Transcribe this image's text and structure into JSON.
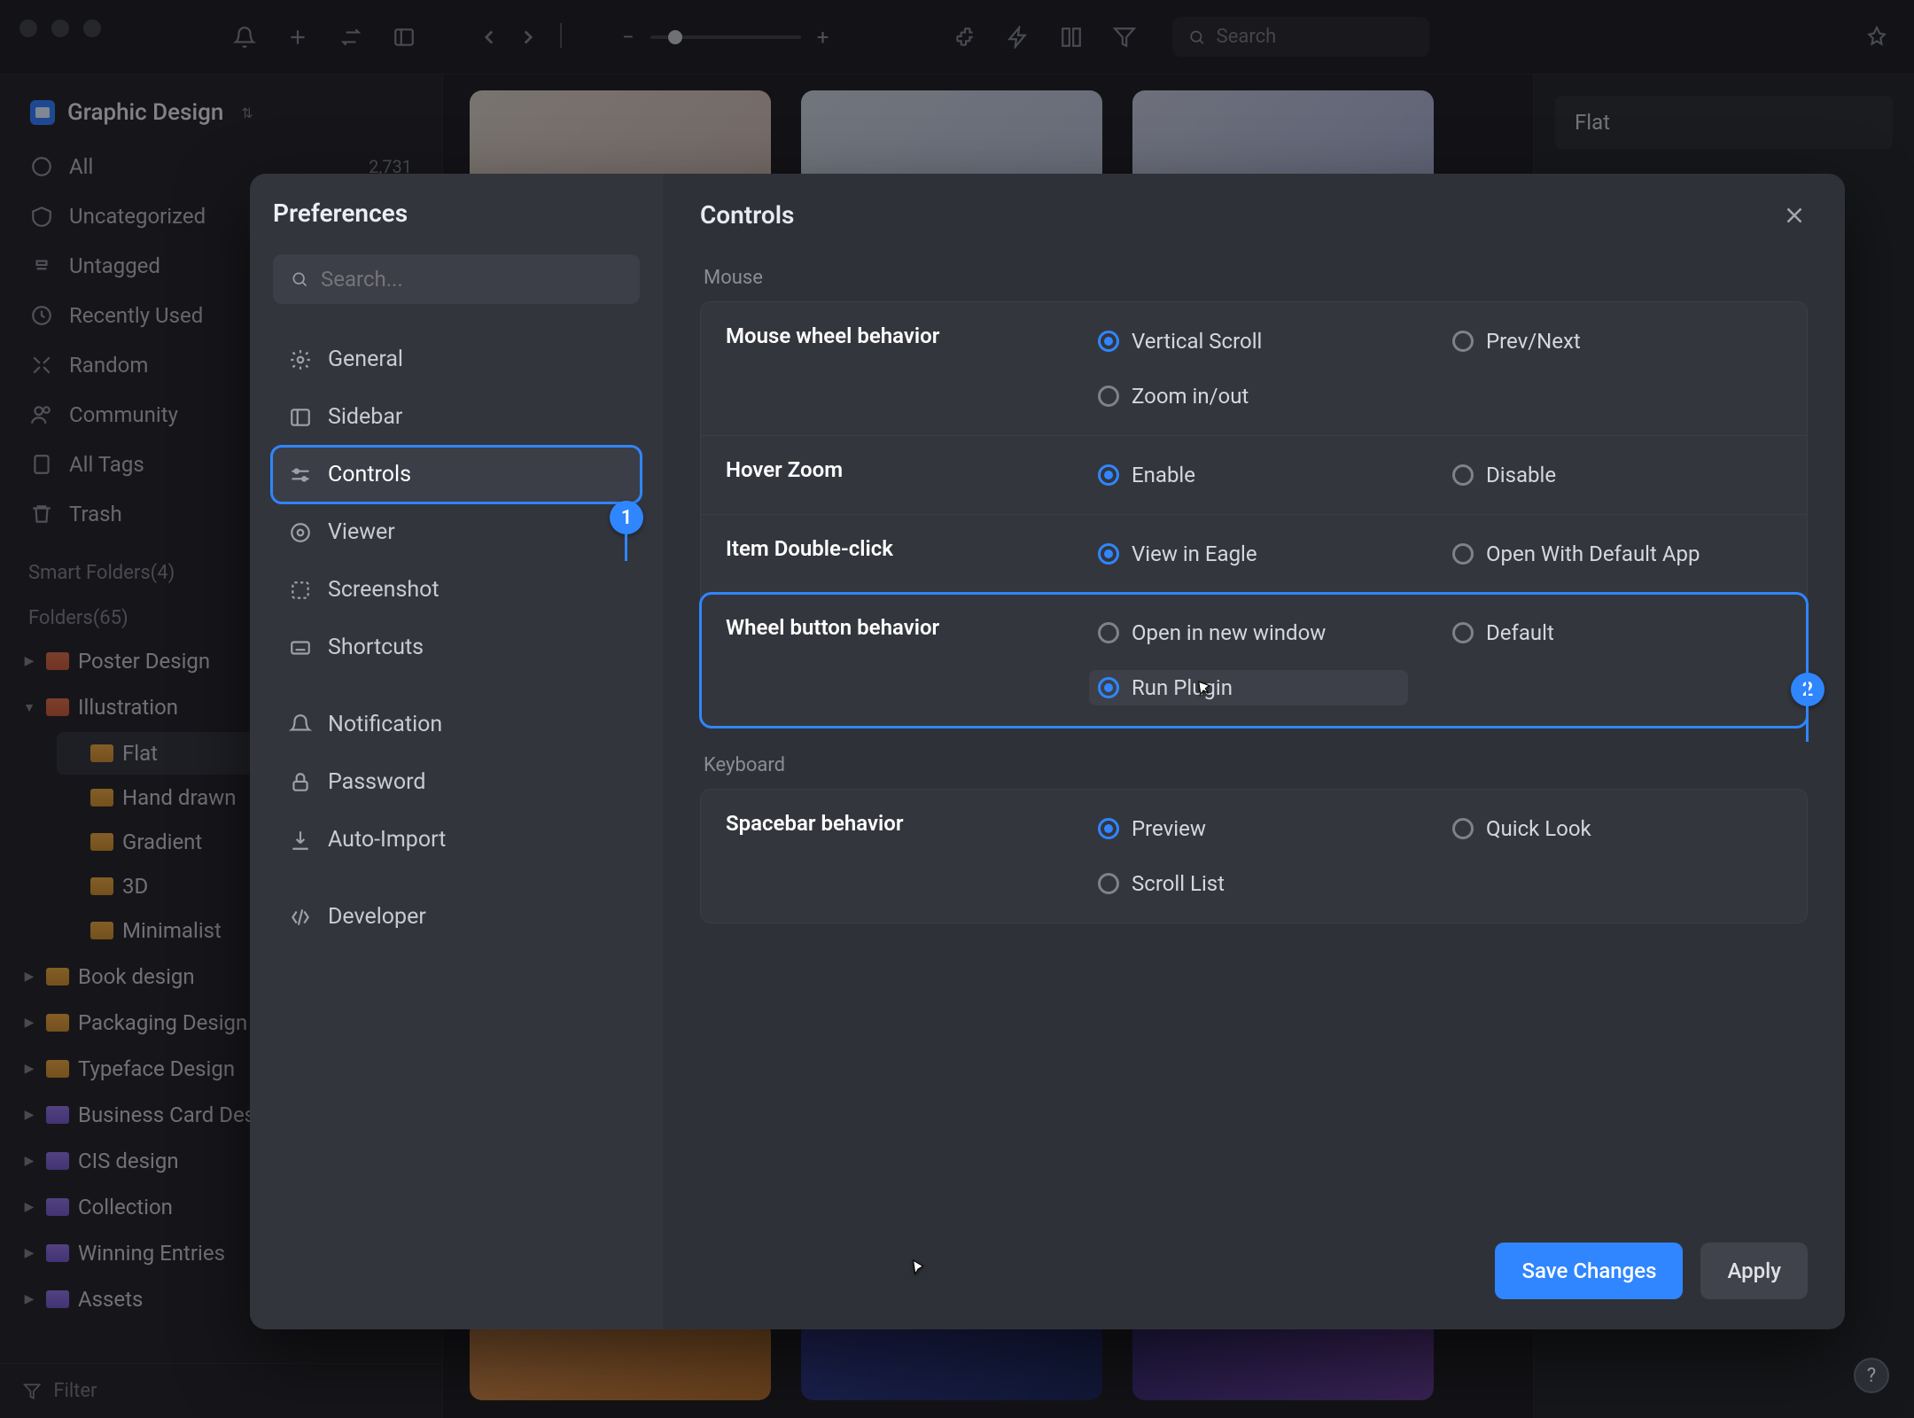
{
  "window": {
    "library_title": "Graphic Design",
    "search_placeholder": "Search"
  },
  "sidebar": {
    "items": [
      {
        "label": "All",
        "count": "2,731"
      },
      {
        "label": "Uncategorized"
      },
      {
        "label": "Untagged"
      },
      {
        "label": "Recently Used"
      },
      {
        "label": "Random"
      },
      {
        "label": "Community"
      },
      {
        "label": "All Tags"
      },
      {
        "label": "Trash"
      }
    ],
    "smart_label": "Smart Folders(4)",
    "folders_label": "Folders(65)",
    "folders": [
      {
        "label": "Poster Design",
        "color": "red"
      },
      {
        "label": "Illustration",
        "color": "red",
        "open": true,
        "children": [
          {
            "label": "Flat",
            "sel": true
          },
          {
            "label": "Hand drawn"
          },
          {
            "label": "Gradient"
          },
          {
            "label": "3D"
          },
          {
            "label": "Minimalist"
          }
        ]
      },
      {
        "label": "Book design",
        "color": "orange"
      },
      {
        "label": "Packaging Design",
        "color": "orange"
      },
      {
        "label": "Typeface Design",
        "color": "orange"
      },
      {
        "label": "Business Card Design",
        "color": "purple"
      },
      {
        "label": "CIS design",
        "color": "purple"
      },
      {
        "label": "Collection",
        "color": "purple"
      },
      {
        "label": "Winning Entries",
        "color": "purple"
      },
      {
        "label": "Assets",
        "color": "purple"
      }
    ],
    "filter_placeholder": "Filter"
  },
  "right_panel": {
    "title_value": "Flat"
  },
  "modal": {
    "side_title": "Preferences",
    "search_placeholder": "Search...",
    "items": [
      {
        "label": "General"
      },
      {
        "label": "Sidebar"
      },
      {
        "label": "Controls",
        "sel": true
      },
      {
        "label": "Viewer"
      },
      {
        "label": "Screenshot"
      },
      {
        "label": "Shortcuts"
      },
      {
        "label": "Notification"
      },
      {
        "label": "Password"
      },
      {
        "label": "Auto-Import"
      },
      {
        "label": "Developer"
      }
    ],
    "title": "Controls",
    "group_mouse": "Mouse",
    "group_keyboard": "Keyboard",
    "settings": {
      "mouse_wheel": {
        "label": "Mouse wheel behavior",
        "opts": [
          "Vertical Scroll",
          "Prev/Next",
          "Zoom in/out"
        ],
        "sel": 0
      },
      "hover_zoom": {
        "label": "Hover Zoom",
        "opts": [
          "Enable",
          "Disable"
        ],
        "sel": 0
      },
      "double_click": {
        "label": "Item Double-click",
        "opts": [
          "View in Eagle",
          "Open With Default App"
        ],
        "sel": 0
      },
      "wheel_button": {
        "label": "Wheel button behavior",
        "opts": [
          "Open in new window",
          "Default",
          "Run Plugin"
        ],
        "sel": 2
      },
      "spacebar": {
        "label": "Spacebar behavior",
        "opts": [
          "Preview",
          "Quick Look",
          "Scroll List"
        ],
        "sel": 0
      }
    },
    "callouts": {
      "one": "1",
      "two": "2"
    },
    "buttons": {
      "save": "Save Changes",
      "apply": "Apply"
    }
  }
}
